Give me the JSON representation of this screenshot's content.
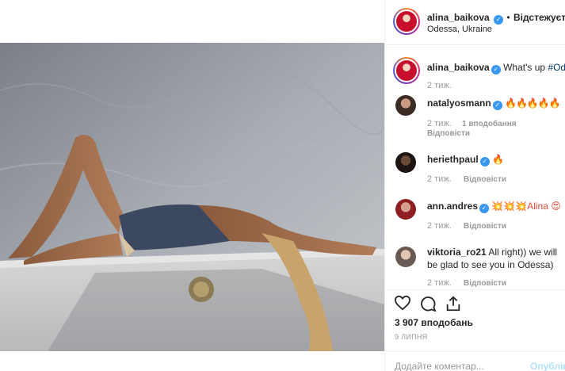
{
  "post": {
    "author": "alina_baikova",
    "follow_status": "Відстежується",
    "separator": "•",
    "location": "Odessa, Ukraine"
  },
  "caption": {
    "author": "alina_baikova",
    "text": "What's up",
    "hashtag": "#Odess",
    "time": "2 тиж."
  },
  "comments": [
    {
      "user": "natalyosmann",
      "text": "🔥🔥🔥🔥🔥",
      "time": "2 тиж.",
      "likes": "1 вподобання",
      "reply": "Відповісти"
    },
    {
      "user": "heriethpaul",
      "text": "🔥",
      "time": "2 тиж.",
      "reply": "Відповісти"
    },
    {
      "user": "ann.andres",
      "text": "💥💥💥Alina 😍",
      "time": "2 тиж.",
      "reply": "Відповісти"
    },
    {
      "user": "viktoria_ro21",
      "text": "All right)) we will be glad to see you in Odessa)",
      "time": "2 тиж.",
      "reply": "Відповісти"
    }
  ],
  "actions": {
    "likes_count": "3 907 вподобань",
    "date": "9 ЛИПНЯ"
  },
  "composer": {
    "placeholder": "Додайте коментар...",
    "publish": "Опублік"
  },
  "colors": {
    "verified": "#3897f0",
    "link": "#003569",
    "muted": "#999999"
  }
}
